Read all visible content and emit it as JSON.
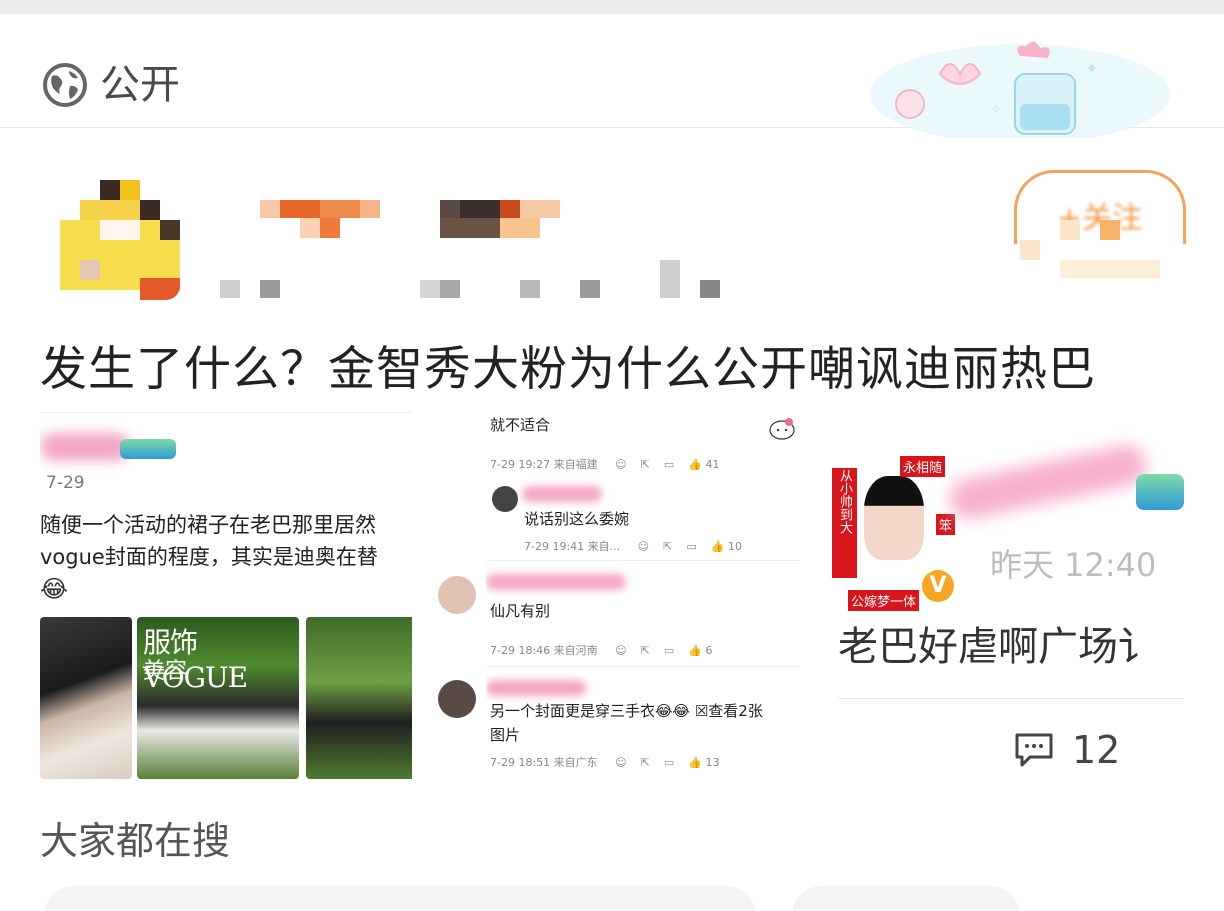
{
  "visibility": {
    "label": "公开",
    "icon": "globe-icon"
  },
  "author": {
    "follow_label": "+关注"
  },
  "post": {
    "title": "发生了什么？金智秀大粉为什么公开嘲讽迪丽热巴"
  },
  "shot_left": {
    "date": "7-29",
    "text_line1": "随便一个活动的裙子在老巴那里居然",
    "text_line2": "vogue封面的程度，其实是迪奥在替",
    "emoji": "😂",
    "magazine_title": "服饰VOGUE",
    "magazine_sub": "美容"
  },
  "shot_mid": {
    "top_text": "就不适合",
    "c1_meta_time": "7-29 19:27",
    "c1_meta_loc": "来自福建",
    "c1_likes": "41",
    "c2_text": "说话别这么委婉",
    "c2_meta_time": "7-29 19:41",
    "c2_meta_loc": "来自...",
    "c2_likes": "10",
    "c3_text": "仙凡有别",
    "c3_meta_time": "7-29 18:46",
    "c3_meta_loc": "来自河南",
    "c3_likes": "6",
    "c4_text_1": "另一个封面更是穿三手衣😂😂 ☒查看2张",
    "c4_text_2": "图片",
    "c4_meta_time": "7-29 18:51",
    "c4_meta_loc": "来自广东",
    "c4_likes": "13"
  },
  "shot_right": {
    "tag1": "从小帅到大",
    "tag2": "永相随",
    "tag3": "笨",
    "tag4": "公嫁梦一体",
    "time": "昨天 12:40",
    "text": "老巴好虐啊广场讠",
    "comment_count": "12"
  },
  "section": {
    "title": "大家都在搜"
  },
  "colors": {
    "accent_orange": "#f08a24",
    "blur_pink": "#f4a6c4"
  }
}
